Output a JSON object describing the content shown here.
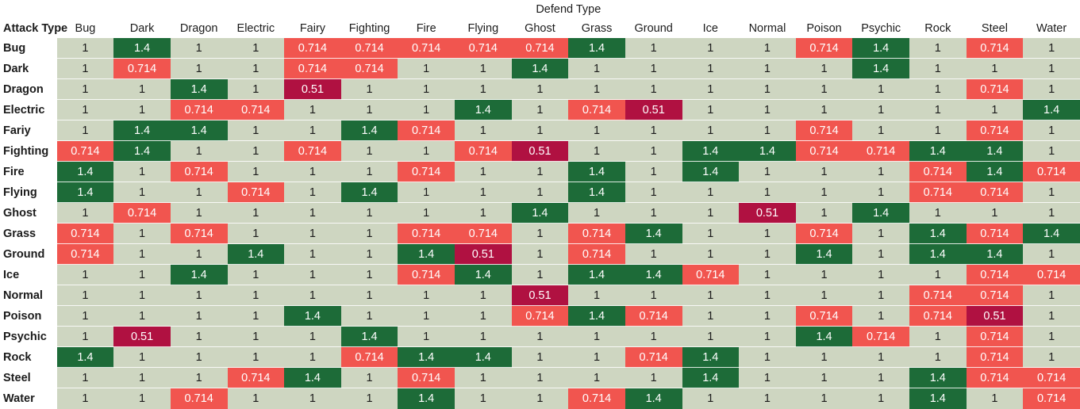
{
  "header": {
    "super_title": "Defend Type",
    "corner_label": "Attack Type"
  },
  "colors": {
    "neutral": "#ced6c1",
    "super_effective": "#1d6b38",
    "not_very_effective": "#f1554f",
    "immune": "#b01141",
    "page_background": "#ffffff",
    "text": "#1b1b1b"
  },
  "chart_data": {
    "type": "heatmap",
    "title": "Defend Type",
    "xlabel": "Defend Type",
    "ylabel": "Attack Type",
    "legend_position": "none",
    "grid": false,
    "value_levels": [
      0.51,
      0.714,
      1,
      1.4
    ],
    "columns": [
      "Bug",
      "Dark",
      "Dragon",
      "Electric",
      "Fairy",
      "Fighting",
      "Fire",
      "Flying",
      "Ghost",
      "Grass",
      "Ground",
      "Ice",
      "Normal",
      "Poison",
      "Psychic",
      "Rock",
      "Steel",
      "Water"
    ],
    "rows": [
      "Bug",
      "Dark",
      "Dragon",
      "Electric",
      "Fariy",
      "Fighting",
      "Fire",
      "Flying",
      "Ghost",
      "Grass",
      "Ground",
      "Ice",
      "Normal",
      "Poison",
      "Psychic",
      "Rock",
      "Steel",
      "Water"
    ],
    "values": [
      [
        1,
        1.4,
        1,
        1,
        0.714,
        0.714,
        0.714,
        0.714,
        0.714,
        1.4,
        1,
        1,
        1,
        0.714,
        1.4,
        1,
        0.714,
        1
      ],
      [
        1,
        0.714,
        1,
        1,
        0.714,
        0.714,
        1,
        1,
        1.4,
        1,
        1,
        1,
        1,
        1,
        1.4,
        1,
        1,
        1
      ],
      [
        1,
        1,
        1.4,
        1,
        0.51,
        1,
        1,
        1,
        1,
        1,
        1,
        1,
        1,
        1,
        1,
        1,
        0.714,
        1
      ],
      [
        1,
        1,
        0.714,
        0.714,
        1,
        1,
        1,
        1.4,
        1,
        0.714,
        0.51,
        1,
        1,
        1,
        1,
        1,
        1,
        1.4
      ],
      [
        1,
        1.4,
        1.4,
        1,
        1,
        1.4,
        0.714,
        1,
        1,
        1,
        1,
        1,
        1,
        0.714,
        1,
        1,
        0.714,
        1
      ],
      [
        0.714,
        1.4,
        1,
        1,
        0.714,
        1,
        1,
        0.714,
        0.51,
        1,
        1,
        1.4,
        1.4,
        0.714,
        0.714,
        1.4,
        1.4,
        1
      ],
      [
        1.4,
        1,
        0.714,
        1,
        1,
        1,
        0.714,
        1,
        1,
        1.4,
        1,
        1.4,
        1,
        1,
        1,
        0.714,
        1.4,
        0.714
      ],
      [
        1.4,
        1,
        1,
        0.714,
        1,
        1.4,
        1,
        1,
        1,
        1.4,
        1,
        1,
        1,
        1,
        1,
        0.714,
        0.714,
        1
      ],
      [
        1,
        0.714,
        1,
        1,
        1,
        1,
        1,
        1,
        1.4,
        1,
        1,
        1,
        0.51,
        1,
        1.4,
        1,
        1,
        1
      ],
      [
        0.714,
        1,
        0.714,
        1,
        1,
        1,
        0.714,
        0.714,
        1,
        0.714,
        1.4,
        1,
        1,
        0.714,
        1,
        1.4,
        0.714,
        1.4
      ],
      [
        0.714,
        1,
        1,
        1.4,
        1,
        1,
        1.4,
        0.51,
        1,
        0.714,
        1,
        1,
        1,
        1.4,
        1,
        1.4,
        1.4,
        1
      ],
      [
        1,
        1,
        1.4,
        1,
        1,
        1,
        0.714,
        1.4,
        1,
        1.4,
        1.4,
        0.714,
        1,
        1,
        1,
        1,
        0.714,
        0.714
      ],
      [
        1,
        1,
        1,
        1,
        1,
        1,
        1,
        1,
        0.51,
        1,
        1,
        1,
        1,
        1,
        1,
        0.714,
        0.714,
        1
      ],
      [
        1,
        1,
        1,
        1,
        1.4,
        1,
        1,
        1,
        0.714,
        1.4,
        0.714,
        1,
        1,
        0.714,
        1,
        0.714,
        0.51,
        1
      ],
      [
        1,
        0.51,
        1,
        1,
        1,
        1.4,
        1,
        1,
        1,
        1,
        1,
        1,
        1,
        1.4,
        0.714,
        1,
        0.714,
        1
      ],
      [
        1.4,
        1,
        1,
        1,
        1,
        0.714,
        1.4,
        1.4,
        1,
        1,
        0.714,
        1.4,
        1,
        1,
        1,
        1,
        0.714,
        1
      ],
      [
        1,
        1,
        1,
        0.714,
        1.4,
        1,
        0.714,
        1,
        1,
        1,
        1,
        1.4,
        1,
        1,
        1,
        1.4,
        0.714,
        0.714
      ],
      [
        1,
        1,
        0.714,
        1,
        1,
        1,
        1.4,
        1,
        1,
        0.714,
        1.4,
        1,
        1,
        1,
        1,
        1.4,
        1,
        0.714
      ]
    ]
  }
}
